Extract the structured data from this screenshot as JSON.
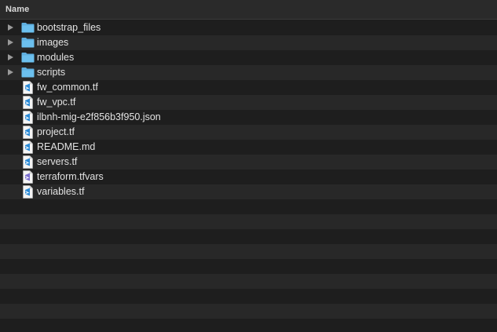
{
  "header": {
    "name_column": "Name"
  },
  "colors": {
    "background": "#1e1e1e",
    "stripe": "#282828",
    "folder": "#5fb0e0",
    "text": "#e2e2e2",
    "vscode_blue": "#2b8ad6"
  },
  "items": [
    {
      "label": "bootstrap_files",
      "kind": "folder",
      "icon": "folder-icon"
    },
    {
      "label": "images",
      "kind": "folder",
      "icon": "folder-icon"
    },
    {
      "label": "modules",
      "kind": "folder",
      "icon": "folder-icon"
    },
    {
      "label": "scripts",
      "kind": "folder",
      "icon": "folder-icon"
    },
    {
      "label": "fw_common.tf",
      "kind": "file",
      "icon": "vscode-file-icon"
    },
    {
      "label": "fw_vpc.tf",
      "kind": "file",
      "icon": "vscode-file-icon"
    },
    {
      "label": "ilbnh-mig-e2f856b3f950.json",
      "kind": "file",
      "icon": "vscode-file-icon"
    },
    {
      "label": "project.tf",
      "kind": "file",
      "icon": "vscode-file-icon"
    },
    {
      "label": "README.md",
      "kind": "file",
      "icon": "vscode-file-icon"
    },
    {
      "label": "servers.tf",
      "kind": "file",
      "icon": "vscode-file-icon"
    },
    {
      "label": "terraform.tfvars",
      "kind": "file",
      "icon": "tfvars-file-icon"
    },
    {
      "label": "variables.tf",
      "kind": "file",
      "icon": "vscode-file-icon"
    }
  ]
}
